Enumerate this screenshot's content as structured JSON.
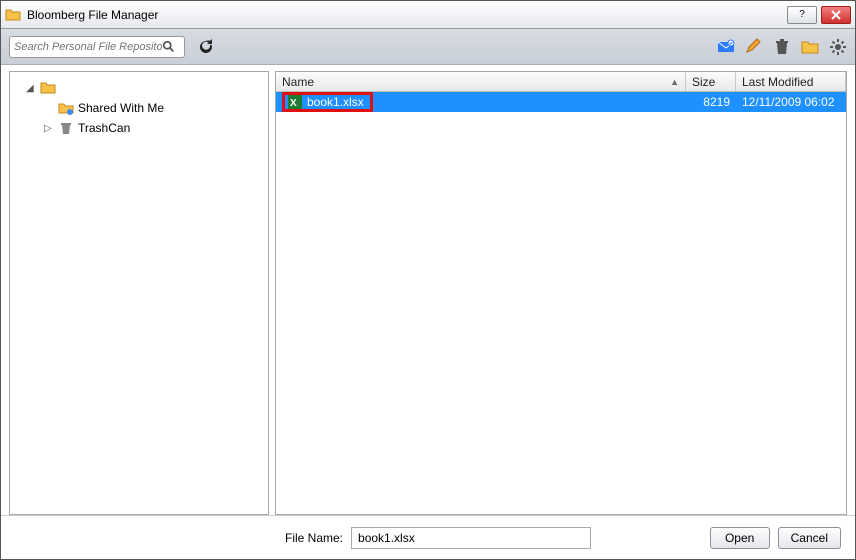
{
  "window": {
    "title": "Bloomberg File Manager"
  },
  "toolbar": {
    "search_placeholder": "Search Personal File Repository",
    "icons": {
      "refresh": "refresh-icon",
      "mail": "mail-icon",
      "pencil": "pencil-icon",
      "trash": "trash-icon",
      "folder": "folder-icon",
      "gear": "gear-icon"
    }
  },
  "sidebar": {
    "root": {
      "label": ""
    },
    "items": [
      {
        "label": "Shared With Me",
        "icon": "shared-folder-icon"
      },
      {
        "label": "TrashCan",
        "icon": "trashcan-icon"
      }
    ]
  },
  "list": {
    "columns": {
      "name": "Name",
      "size": "Size",
      "modified": "Last Modified"
    },
    "rows": [
      {
        "name": "book1.xlsx",
        "size": "8219",
        "modified": "12/11/2009 06:02",
        "selected": true
      }
    ]
  },
  "footer": {
    "filename_label": "File Name:",
    "filename_value": "book1.xlsx",
    "open_label": "Open",
    "cancel_label": "Cancel"
  }
}
